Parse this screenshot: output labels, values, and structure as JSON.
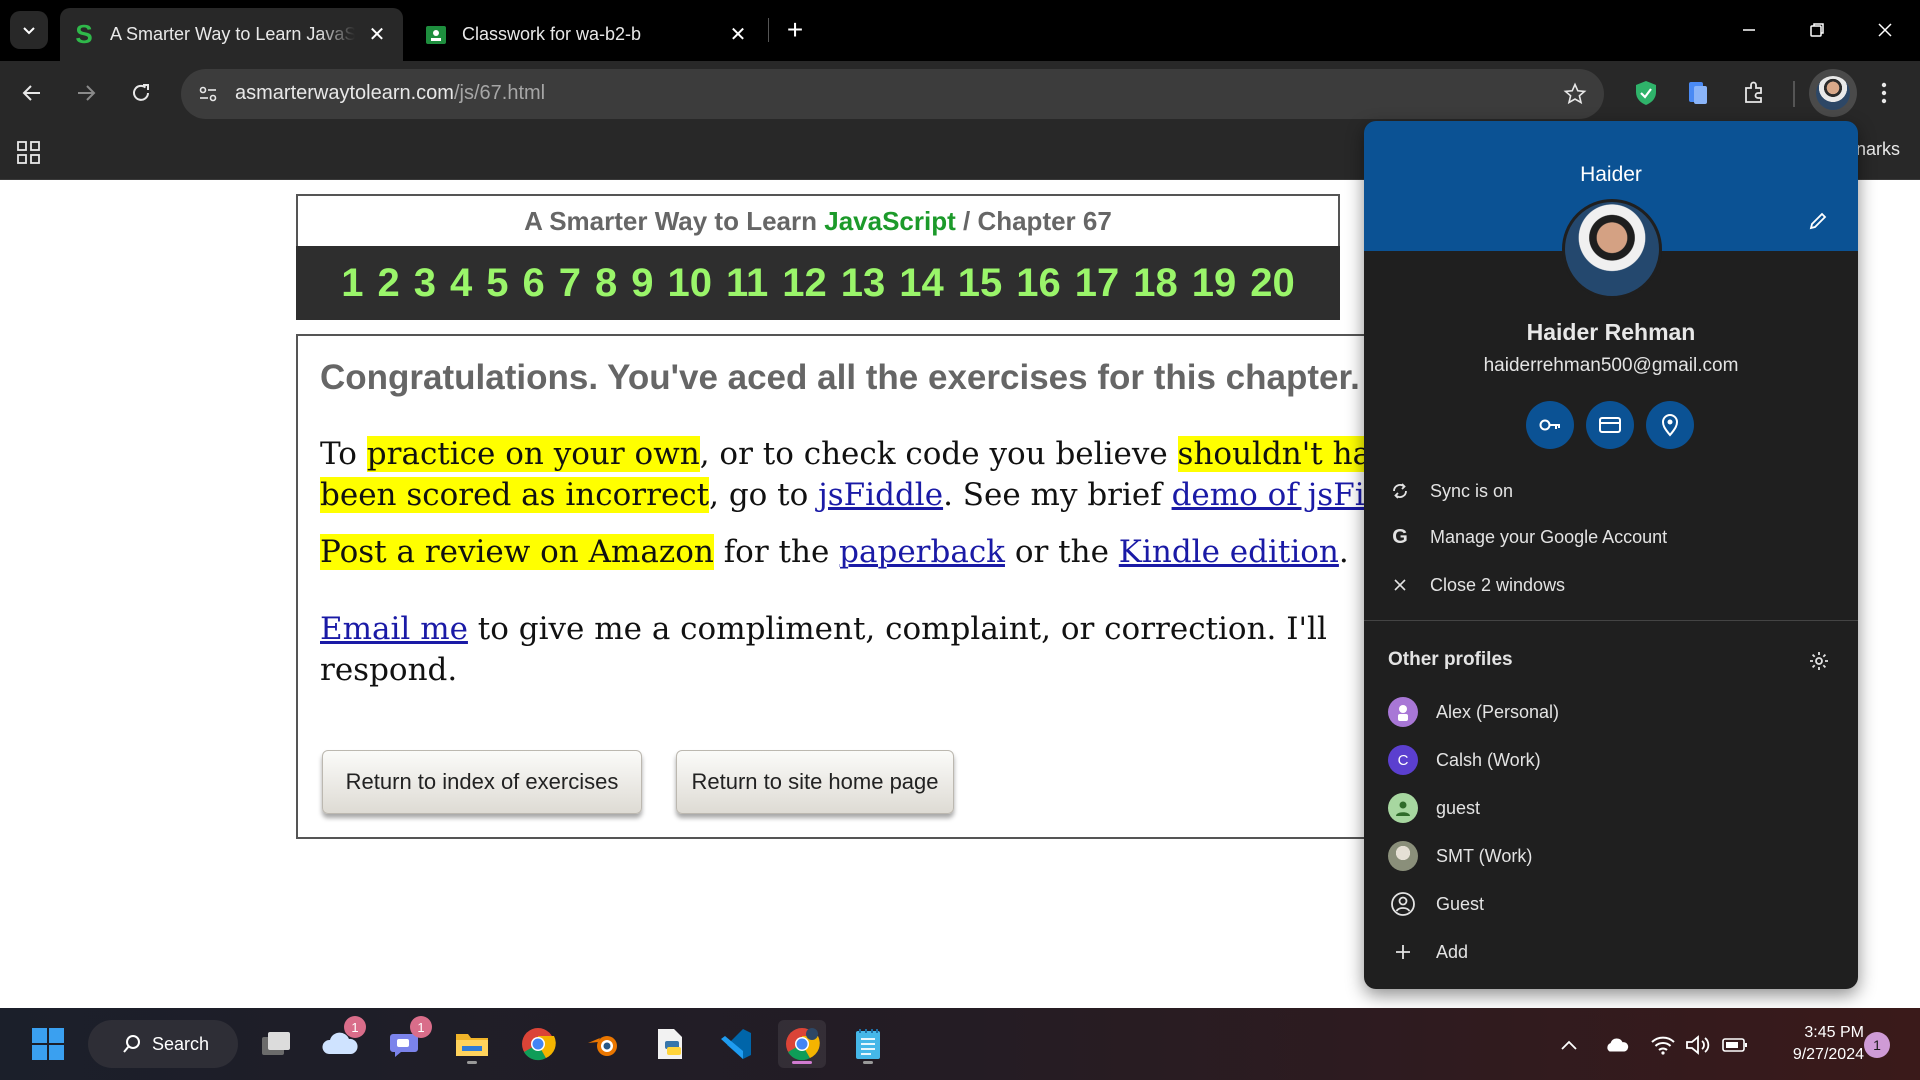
{
  "browser": {
    "tabs": [
      {
        "title": "A Smarter Way to Learn JavaScript",
        "favicon": "S"
      },
      {
        "title": "Classwork for wa-b2-b"
      }
    ],
    "url_domain": "asmarterwaytolearn.com",
    "url_path": "/js/67.html",
    "bookmarks_partial": "narks"
  },
  "page": {
    "header_title": "A Smarter Way to Learn",
    "header_js": "JavaScript",
    "header_sep": " / ",
    "header_chapter": "Chapter 67",
    "chapter_numbers": [
      "1",
      "2",
      "3",
      "4",
      "5",
      "6",
      "7",
      "8",
      "9",
      "10",
      "11",
      "12",
      "13",
      "14",
      "15",
      "16",
      "17",
      "18",
      "19",
      "20"
    ],
    "congrats": "Congratulations. You've aced all the exercises for this chapter.",
    "p1": {
      "t1": "To ",
      "h1": "practice on your own",
      "t2": ", or to check code you believe ",
      "h2": "shouldn't have been scored as incorrect",
      "t3": ", go to ",
      "l1": "jsFiddle",
      "t4": ". See my brief ",
      "l2": "demo of jsFiddle"
    },
    "p2": {
      "h1": "Post a review on Amazon",
      "t1": " for the ",
      "l1": "paperback",
      "t2": " or the ",
      "l2": "Kindle edition",
      "t3": "."
    },
    "p3": {
      "l1": "Email me",
      "t1": " to give me a compliment, complaint, or correction. I'll respond."
    },
    "button_index": "Return to index of exercises",
    "button_home": "Return to site home page"
  },
  "profile_popup": {
    "banner_name": "Haider",
    "full_name": "Haider Rehman",
    "email": "haiderrehman500@gmail.com",
    "menu": [
      {
        "icon": "sync-icon",
        "label": "Sync is on"
      },
      {
        "icon": "google-icon",
        "label": "Manage your Google Account"
      },
      {
        "icon": "close-icon",
        "label": "Close 2 windows"
      }
    ],
    "other_profiles_title": "Other profiles",
    "profiles": [
      {
        "label": "Alex (Personal)",
        "color": "#a877d6"
      },
      {
        "label": "Calsh (Work)",
        "initial": "C",
        "color": "#5b3fcf"
      },
      {
        "label": "guest",
        "color": "#a7d7a0"
      },
      {
        "label": "SMT (Work)",
        "color": "#8a8f7a"
      },
      {
        "label": "Guest",
        "color": "transparent"
      },
      {
        "label": "Add",
        "color": "transparent"
      }
    ]
  },
  "taskbar": {
    "search_label": "Search",
    "badge_onedrive": "1",
    "badge_teams": "1",
    "time": "3:45 PM",
    "date": "9/27/2024",
    "notification_count": "1"
  },
  "colors": {
    "accent_blue": "#0b5294",
    "js_green": "#1c9a2a",
    "chapter_green": "#9af56a",
    "highlight": "#ffff00"
  }
}
